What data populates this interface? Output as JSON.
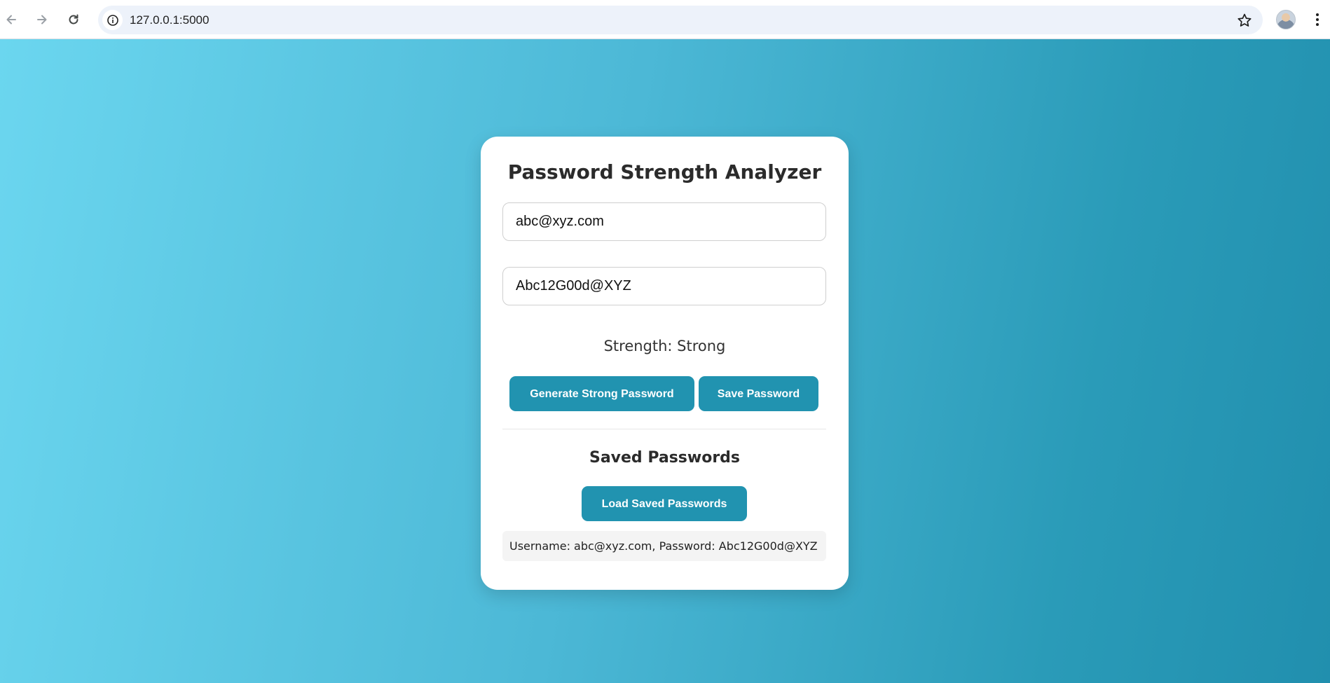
{
  "browser": {
    "url": "127.0.0.1:5000",
    "icons": {
      "back": "back-arrow-icon",
      "forward": "forward-arrow-icon",
      "reload": "reload-icon",
      "site_info": "info-icon",
      "bookmark": "star-icon",
      "profile": "avatar",
      "menu": "kebab-menu-icon"
    }
  },
  "app": {
    "title": "Password Strength Analyzer",
    "username_value": "abc@xyz.com",
    "password_value": "Abc12G00d@XYZ",
    "strength_text": "Strength: Strong",
    "buttons": {
      "generate": "Generate Strong Password",
      "save": "Save Password",
      "load": "Load Saved Passwords"
    },
    "saved_section_title": "Saved Passwords",
    "saved_entries": [
      "Username: abc@xyz.com, Password: Abc12G00d@XYZ"
    ]
  },
  "colors": {
    "accent": "#2193b0",
    "gradient_start": "#6bd6ef",
    "gradient_end": "#218fae",
    "card_background": "#ffffff"
  }
}
